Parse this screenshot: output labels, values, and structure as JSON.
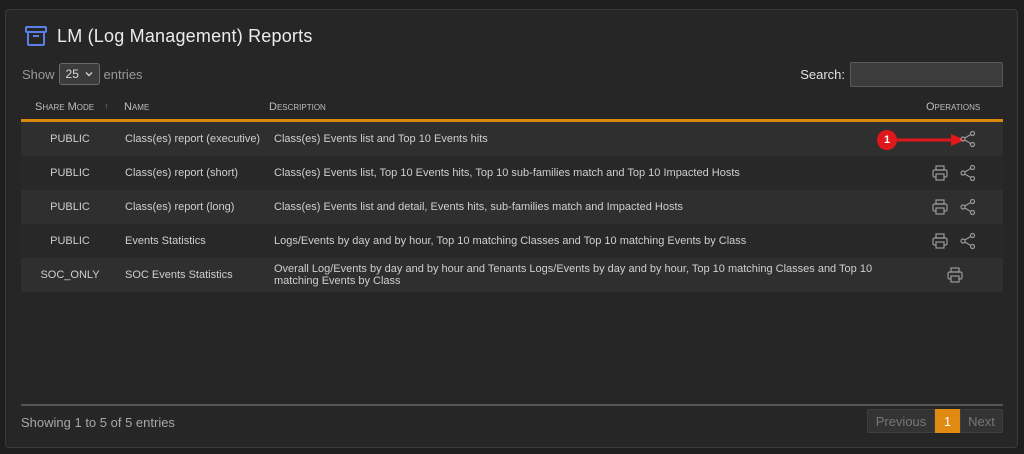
{
  "header": {
    "title": "LM (Log Management) Reports",
    "icon": "archive-box-icon"
  },
  "length": {
    "show_label": "Show",
    "selected": "25",
    "entries_label": "entries"
  },
  "search": {
    "label": "Search:",
    "value": ""
  },
  "columns": {
    "share_mode": "Share Mode",
    "name": "Name",
    "description": "Description",
    "operations": "Operations"
  },
  "rows": [
    {
      "mode": "PUBLIC",
      "name": "Class(es) report (executive)",
      "description": "Class(es) Events list and Top 10 Events hits",
      "ops": [
        "share-icon"
      ]
    },
    {
      "mode": "PUBLIC",
      "name": "Class(es) report (short)",
      "description": "Class(es) Events list, Top 10 Events hits, Top 10 sub-families match and Top 10 Impacted Hosts",
      "ops": [
        "print-icon",
        "share-icon"
      ]
    },
    {
      "mode": "PUBLIC",
      "name": "Class(es) report (long)",
      "description": "Class(es) Events list and detail, Events hits, sub-families match and Impacted Hosts",
      "ops": [
        "print-icon",
        "share-icon"
      ]
    },
    {
      "mode": "PUBLIC",
      "name": "Events Statistics",
      "description": "Logs/Events by day and by hour, Top 10 matching Classes and Top 10 matching Events by Class",
      "ops": [
        "print-icon",
        "share-icon"
      ]
    },
    {
      "mode": "SOC_ONLY",
      "name": "SOC Events Statistics",
      "description": "Overall Log/Events by day and by hour and Tenants Logs/Events by day and by hour, Top 10 matching Classes and Top 10 matching Events by Class",
      "ops": [
        "print-icon"
      ]
    }
  ],
  "annotation": {
    "badge": "1",
    "color": "#e0181c"
  },
  "footer": {
    "info": "Showing 1 to 5 of 5 entries"
  },
  "pager": {
    "previous": "Previous",
    "current": "1",
    "next": "Next"
  },
  "colors": {
    "accent": "#d98a0a",
    "background": "#262626"
  }
}
